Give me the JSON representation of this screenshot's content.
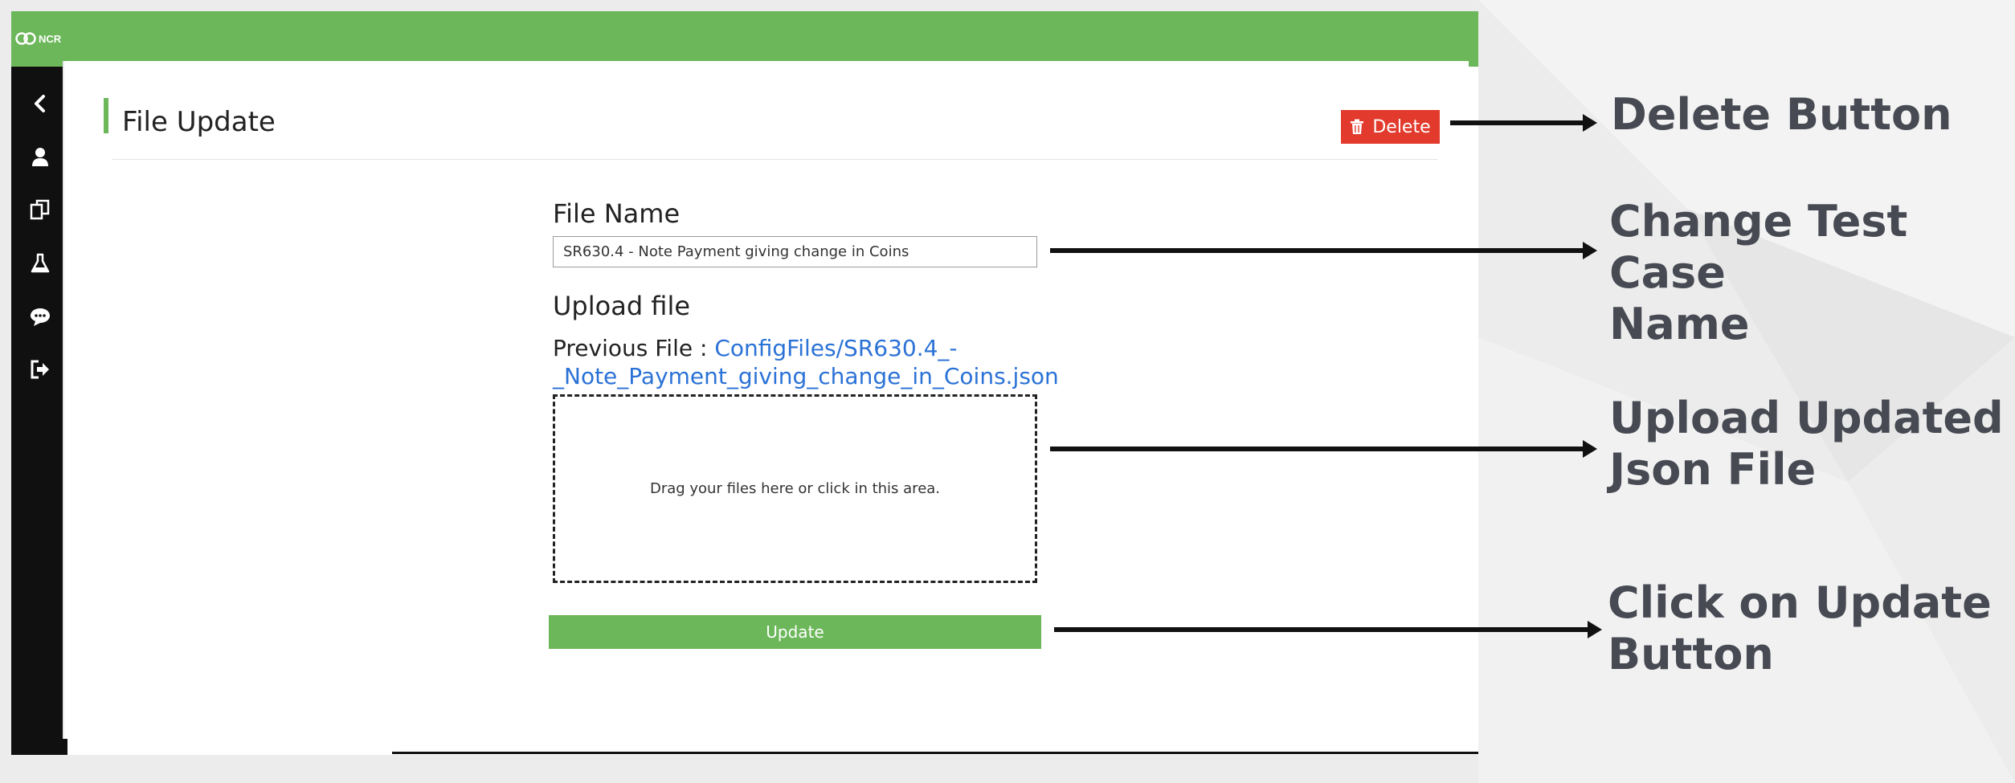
{
  "app": {
    "logo_text": "NCR"
  },
  "sidebar": {
    "items": [
      {
        "icon": "chevron-left-icon"
      },
      {
        "icon": "user-icon"
      },
      {
        "icon": "copy-files-icon"
      },
      {
        "icon": "flask-icon"
      },
      {
        "icon": "chat-icon"
      },
      {
        "icon": "sign-out-icon"
      }
    ]
  },
  "page": {
    "title": "File Update",
    "delete_label": "Delete",
    "file_name_label": "File Name",
    "file_name_value": "SR630.4 - Note Payment giving change in Coins",
    "upload_label": "Upload file",
    "previous_file_prefix": "Previous File : ",
    "previous_file_link": "ConfigFiles/SR630.4_-_Note_Payment_giving_change_in_Coins.json",
    "previous_file_link_line1": "ConfigFiles/SR630.4_-",
    "previous_file_link_line2": "_Note_Payment_giving_change_in_Coins.json",
    "dropzone_text": "Drag your files here or click in this area.",
    "update_label": "Update"
  },
  "annotations": {
    "delete": "Delete Button",
    "change_name_line1": "Change Test Case",
    "change_name_line2": "Name",
    "upload_line1": "Upload Updated",
    "upload_line2": "Json File",
    "update_line1": "Click on Update",
    "update_line2": "Button"
  },
  "colors": {
    "accent_green": "#6cb75a",
    "delete_red": "#e23a2c",
    "link_blue": "#2b72d6",
    "sidebar": "#101010",
    "annotation_text": "#474a53"
  }
}
